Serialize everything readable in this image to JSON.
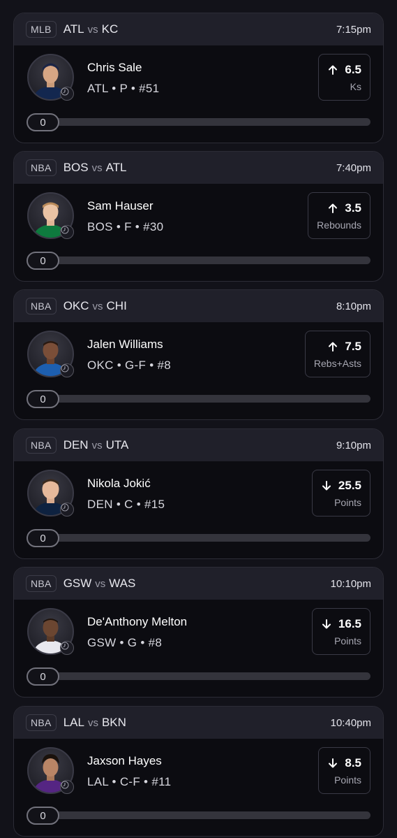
{
  "cards": [
    {
      "league": "MLB",
      "home": "ATL",
      "vs": "vs",
      "away": "KC",
      "time": "7:15pm",
      "player": {
        "name": "Chris Sale",
        "meta": "ATL • P • #51",
        "jersey_color": "#13274f"
      },
      "projection": {
        "direction": "up",
        "value": "6.5",
        "stat": "Ks"
      },
      "progress": {
        "count": "0",
        "fraction": 0
      }
    },
    {
      "league": "NBA",
      "home": "BOS",
      "vs": "vs",
      "away": "ATL",
      "time": "7:40pm",
      "player": {
        "name": "Sam Hauser",
        "meta": "BOS • F • #30",
        "jersey_color": "#0e7a3e"
      },
      "projection": {
        "direction": "up",
        "value": "3.5",
        "stat": "Rebounds"
      },
      "progress": {
        "count": "0",
        "fraction": 0
      }
    },
    {
      "league": "NBA",
      "home": "OKC",
      "vs": "vs",
      "away": "CHI",
      "time": "8:10pm",
      "player": {
        "name": "Jalen Williams",
        "meta": "OKC • G-F • #8",
        "jersey_color": "#1d5fb0"
      },
      "projection": {
        "direction": "up",
        "value": "7.5",
        "stat": "Rebs+Asts"
      },
      "progress": {
        "count": "0",
        "fraction": 0
      }
    },
    {
      "league": "NBA",
      "home": "DEN",
      "vs": "vs",
      "away": "UTA",
      "time": "9:10pm",
      "player": {
        "name": "Nikola Jokić",
        "meta": "DEN • C • #15",
        "jersey_color": "#0e2240"
      },
      "projection": {
        "direction": "down",
        "value": "25.5",
        "stat": "Points"
      },
      "progress": {
        "count": "0",
        "fraction": 0
      }
    },
    {
      "league": "NBA",
      "home": "GSW",
      "vs": "vs",
      "away": "WAS",
      "time": "10:10pm",
      "player": {
        "name": "De'Anthony Melton",
        "meta": "GSW • G • #8",
        "jersey_color": "#e8e8ee"
      },
      "projection": {
        "direction": "down",
        "value": "16.5",
        "stat": "Points"
      },
      "progress": {
        "count": "0",
        "fraction": 0
      }
    },
    {
      "league": "NBA",
      "home": "LAL",
      "vs": "vs",
      "away": "BKN",
      "time": "10:40pm",
      "player": {
        "name": "Jaxson Hayes",
        "meta": "LAL • C-F • #11",
        "jersey_color": "#552583"
      },
      "projection": {
        "direction": "down",
        "value": "8.5",
        "stat": "Points"
      },
      "progress": {
        "count": "0",
        "fraction": 0
      }
    }
  ]
}
